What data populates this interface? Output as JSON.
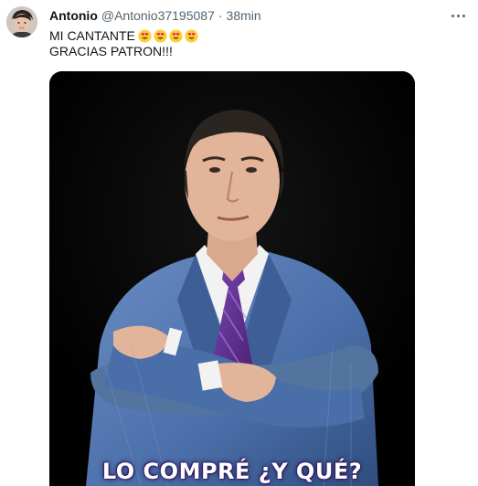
{
  "tweet": {
    "author_name": "Antonio",
    "handle": "@Antonio37195087",
    "separator": "·",
    "time": "38min",
    "text_line1": "MI CANTANTE",
    "emoji_count": 4,
    "emoji_name": "smiling-face-with-heart-eyes",
    "text_line2": "GRACIAS PATRON!!!",
    "image_caption": "LO COMPRÉ ¿Y QUÉ?"
  },
  "colors": {
    "name": "#0f1419",
    "secondary": "#536471",
    "image_background": "#000000",
    "suit": "#4a6ea8",
    "tie": "#5b2a86"
  }
}
